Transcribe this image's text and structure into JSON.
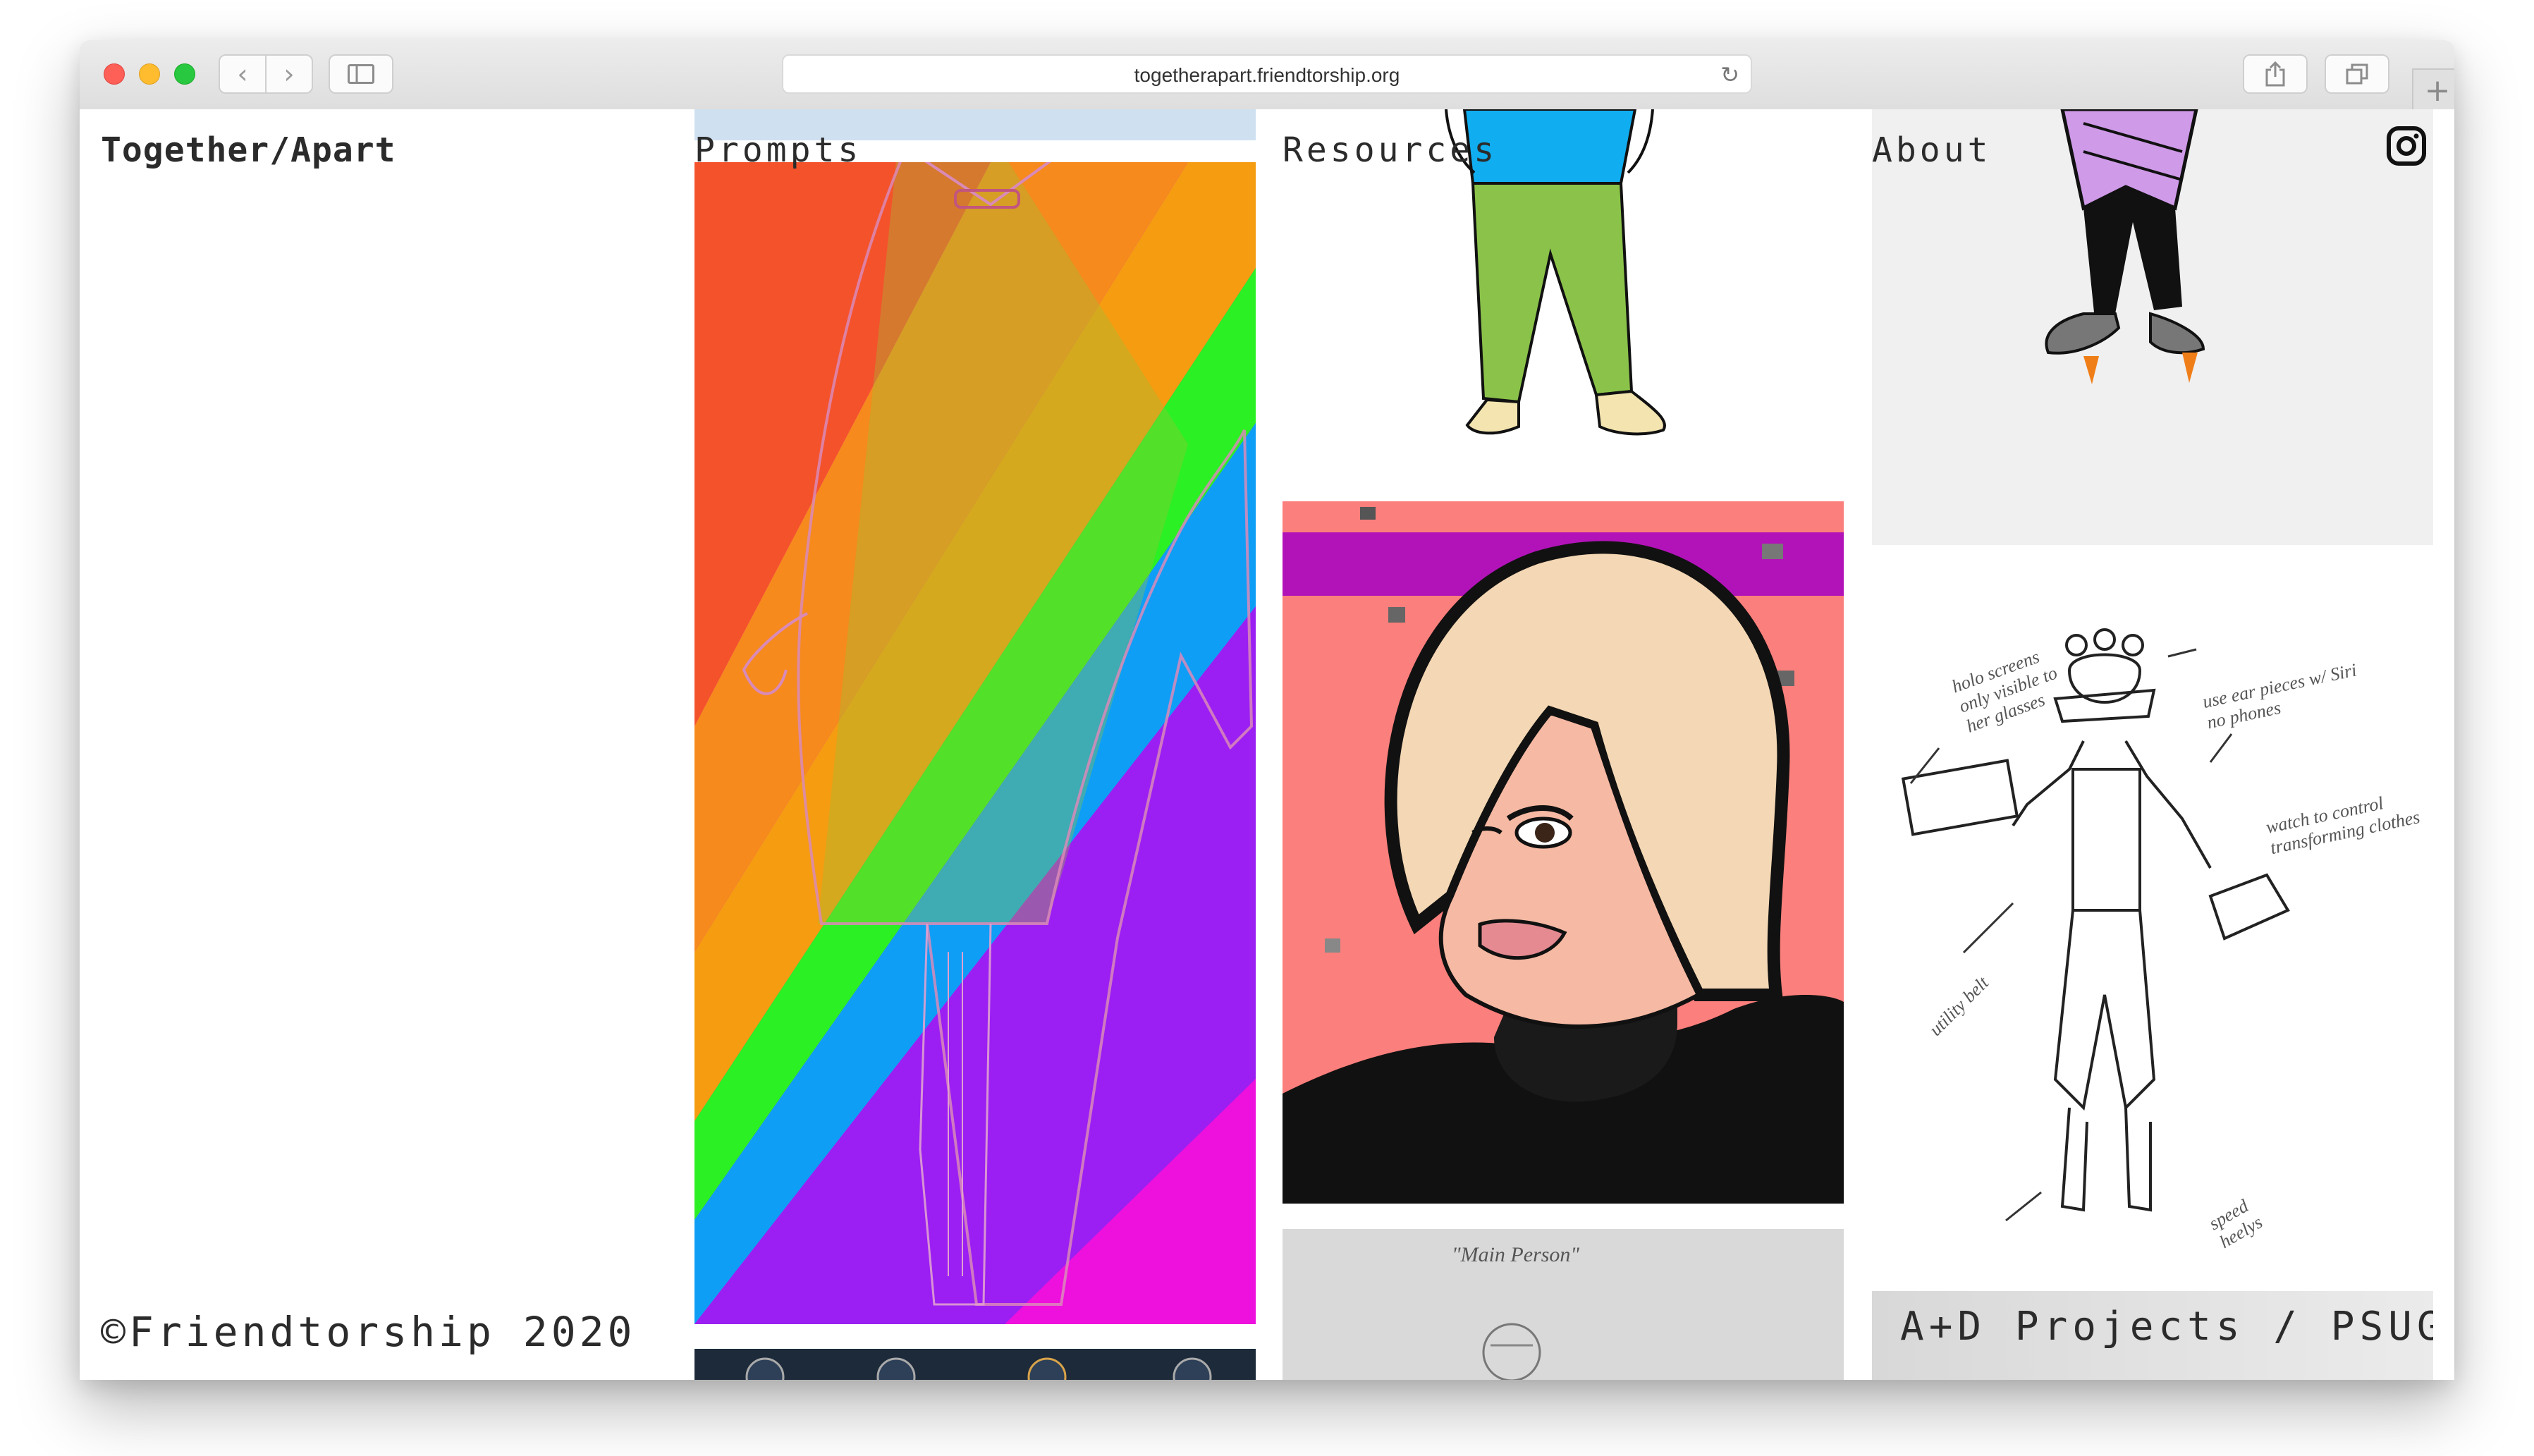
{
  "browser": {
    "url": "togetherapart.friendtorship.org",
    "back_icon": "chevron-left-icon",
    "forward_icon": "chevron-right-icon",
    "sidebar_icon": "sidebar-icon",
    "share_icon": "share-icon",
    "tabs_icon": "tabs-icon",
    "reload_icon": "reload-icon",
    "new_tab_icon": "plus-icon"
  },
  "site": {
    "title": "Together/Apart",
    "nav": [
      "Prompts",
      "Resources",
      "About"
    ],
    "social_icon": "instagram-icon",
    "footer": "©Friendtorship 2020"
  },
  "gallery": {
    "rainbow_artwork": {
      "stripe_colors": [
        "#f4522b",
        "#f68a1c",
        "#f59c11",
        "#2bf024",
        "#0e9ef6",
        "#9b1ff2",
        "#ee10dd"
      ]
    },
    "portrait_artwork": {
      "background": "#fb7f7c",
      "band": "#b213b8"
    },
    "sketch_annotations": [
      "holo screens only visible to her glasses",
      "use ear pieces w/ Siri no phones",
      "watch to control transforming clothes",
      "utility belt",
      "speed heelys"
    ],
    "pencil_caption": "\"Main Person\"",
    "project_label": "A+D Projects / PSUGD"
  }
}
